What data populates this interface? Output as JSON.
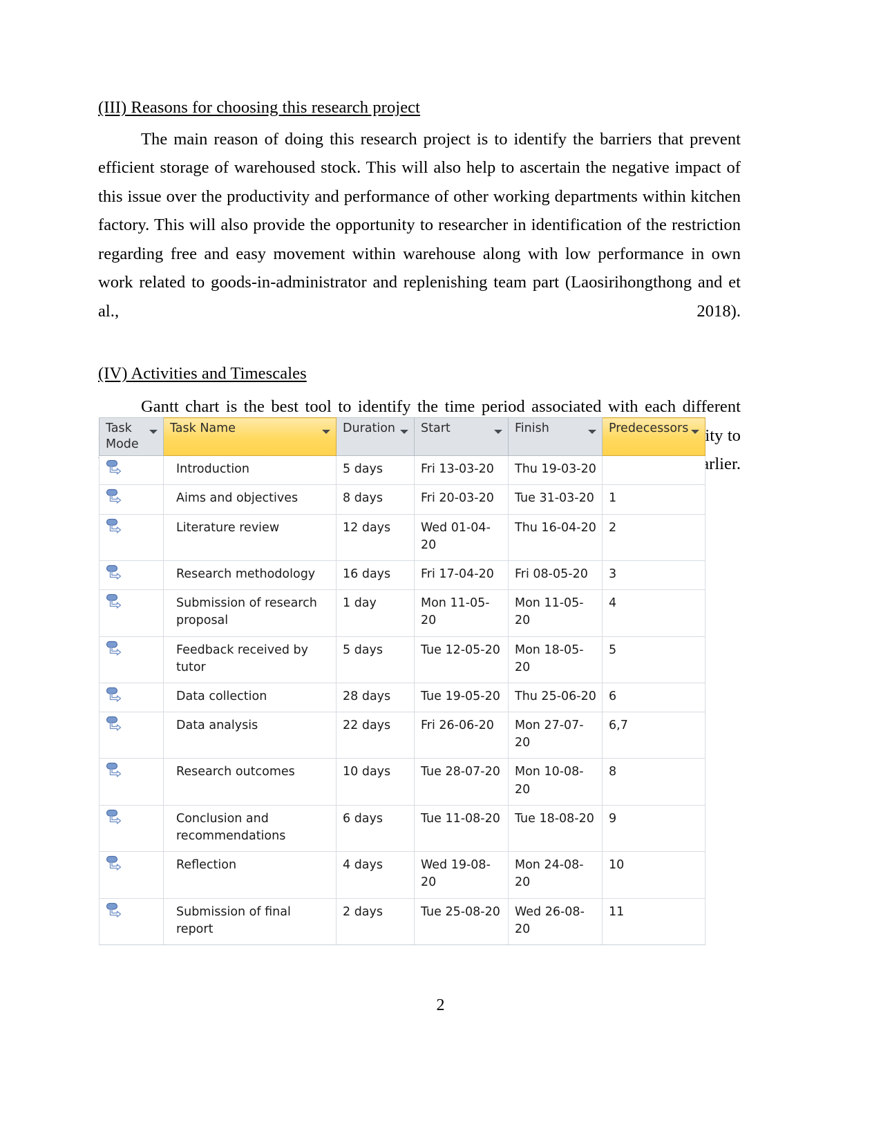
{
  "document": {
    "page_number": "2"
  },
  "sections": [
    {
      "heading": "(III) Reasons for choosing this research project",
      "paragraph": "The main reason of doing this research project is to identify the barriers that prevent efficient storage of warehoused stock. This will also help to ascertain the negative impact of this issue over the productivity and performance of other working departments within kitchen factory. This will also provide the opportunity to researcher in identification of the restriction regarding free and easy movement within warehouse along with low performance in own work related to goods-in-administrator and replenishing team part (Laosirihongthong and et al., 2018)."
    },
    {
      "heading": "(IV) Activities and Timescales",
      "paragraph": "Gantt chart is the best tool to identify the time period associated with each different activity of research project (Amjad and et. al., 2018). This will also provide the opportunity to know about the sequence of activities needed to perform after completion of its earlier."
    }
  ],
  "project_table": {
    "columns": [
      {
        "label": "Task Mode",
        "highlight": false,
        "filter_icon": "chevron-down-icon"
      },
      {
        "label": "Task Name",
        "highlight": true,
        "filter_icon": "chevron-down-icon"
      },
      {
        "label": "Duration",
        "highlight": false,
        "filter_icon": "chevron-down-icon"
      },
      {
        "label": "Start",
        "highlight": false,
        "filter_icon": "chevron-down-icon"
      },
      {
        "label": "Finish",
        "highlight": false,
        "filter_icon": "chevron-down-icon"
      },
      {
        "label": "Predecessors",
        "highlight": true,
        "filter_icon": "chevron-down-icon"
      }
    ],
    "task_mode_icon": "auto-scheduled-icon",
    "rows": [
      {
        "name": "Introduction",
        "duration": "5 days",
        "start": "Fri 13-03-20",
        "finish": "Thu 19-03-20",
        "predecessors": ""
      },
      {
        "name": "Aims and objectives",
        "duration": "8 days",
        "start": "Fri 20-03-20",
        "finish": "Tue 31-03-20",
        "predecessors": "1"
      },
      {
        "name": "Literature review",
        "duration": "12 days",
        "start": "Wed 01-04-20",
        "finish": "Thu 16-04-20",
        "predecessors": "2"
      },
      {
        "name": "Research methodology",
        "duration": "16 days",
        "start": "Fri 17-04-20",
        "finish": "Fri 08-05-20",
        "predecessors": "3"
      },
      {
        "name": "Submission of research proposal",
        "duration": "1 day",
        "start": "Mon 11-05-20",
        "finish": "Mon 11-05-20",
        "predecessors": "4"
      },
      {
        "name": "Feedback received by tutor",
        "duration": "5 days",
        "start": "Tue 12-05-20",
        "finish": "Mon 18-05-20",
        "predecessors": "5"
      },
      {
        "name": "Data collection",
        "duration": "28 days",
        "start": "Tue 19-05-20",
        "finish": "Thu 25-06-20",
        "predecessors": "6"
      },
      {
        "name": "Data analysis",
        "duration": "22 days",
        "start": "Fri 26-06-20",
        "finish": "Mon 27-07-20",
        "predecessors": "6,7"
      },
      {
        "name": "Research outcomes",
        "duration": "10 days",
        "start": "Tue 28-07-20",
        "finish": "Mon 10-08-20",
        "predecessors": "8"
      },
      {
        "name": "Conclusion and recommendations",
        "duration": "6 days",
        "start": "Tue 11-08-20",
        "finish": "Tue 18-08-20",
        "predecessors": "9"
      },
      {
        "name": "Reflection",
        "duration": "4 days",
        "start": "Wed 19-08-20",
        "finish": "Mon 24-08-20",
        "predecessors": "10"
      },
      {
        "name": "Submission of final report",
        "duration": "2 days",
        "start": "Tue 25-08-20",
        "finish": "Wed 26-08-20",
        "predecessors": "11"
      }
    ]
  },
  "colors": {
    "header_bg": "#dfe3e8",
    "header_highlight_bg": "#ffd95e",
    "grid_line": "#d7dde3",
    "icon_blue": "#6f91c9",
    "text": "#1a1a1a"
  }
}
